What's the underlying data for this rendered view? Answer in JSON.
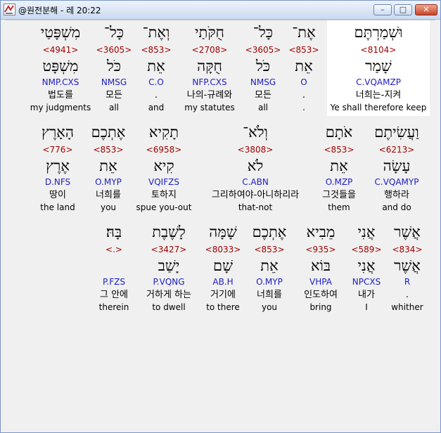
{
  "window": {
    "title": "@원전분해 - 레 20:22",
    "minimize": "–",
    "maximize": "□",
    "close": "✕"
  },
  "rows": [
    {
      "words": [
        {
          "heb": "וּשְׁמַרְתֶּם",
          "strong": "<8104>",
          "lemma": "שָׁמַר",
          "morph": "C.VQAMZP",
          "kor": "너희는-지켜",
          "eng": "Ye shall therefore keep",
          "selected": true
        },
        {
          "heb": "אֶת־",
          "strong": "<853>",
          "lemma": "אֵת",
          "morph": "O",
          "kor": ".",
          "eng": "."
        },
        {
          "heb": "כָּל־",
          "strong": "<3605>",
          "lemma": "כֹּל",
          "morph": "NMSG",
          "kor": "모든",
          "eng": "all"
        },
        {
          "heb": "חֻקֹּתַי",
          "strong": "<2708>",
          "lemma": "חֻקָּה",
          "morph": "NFP.CXS",
          "kor": "나의-규례와",
          "eng": "my statutes"
        },
        {
          "heb": "וְאֶת־",
          "strong": "<853>",
          "lemma": "אֵת",
          "morph": "C.O",
          "kor": ".",
          "eng": "and"
        },
        {
          "heb": "כָּל־",
          "strong": "<3605>",
          "lemma": "כֹּל",
          "morph": "NMSG",
          "kor": "모든",
          "eng": "all"
        },
        {
          "heb": "מִשְׁפָּטַי",
          "strong": "<4941>",
          "lemma": "מִשְׁפָּט",
          "morph": "NMP.CXS",
          "kor": "법도를",
          "eng": "my judgments"
        }
      ]
    },
    {
      "words": [
        {
          "heb": "וַעֲשִׂיתֶם",
          "strong": "<6213>",
          "lemma": "עָשָׂה",
          "morph": "C.VQAMYP",
          "kor": "행하라",
          "eng": "and do"
        },
        {
          "heb": "אֹתָם",
          "strong": "<853>",
          "lemma": "אֵת",
          "morph": "O.MZP",
          "kor": "그것들을",
          "eng": "them"
        },
        {
          "heb": "וְלֹא־",
          "strong": "<3808>",
          "lemma": "לֹא",
          "morph": "C.ABN",
          "kor": "그리하여야-아니하리라",
          "eng": "that-not"
        },
        {
          "heb": "תָקִיא",
          "strong": "<6958>",
          "lemma": "קִיא",
          "morph": "VQIFZS",
          "kor": "토하지",
          "eng": "spue you-out"
        },
        {
          "heb": "אֶתְכֶם",
          "strong": "<853>",
          "lemma": "אֵת",
          "morph": "O.MYP",
          "kor": "너희를",
          "eng": "you"
        },
        {
          "heb": "הָאָרֶץ",
          "strong": "<776>",
          "lemma": "אֶרֶץ",
          "morph": "D.NFS",
          "kor": "땅이",
          "eng": "the land"
        }
      ]
    },
    {
      "words": [
        {
          "heb": "אֲשֶׁר",
          "strong": "<834>",
          "lemma": "אֲשֶׁר",
          "morph": "R",
          "kor": ".",
          "eng": "whither"
        },
        {
          "heb": "אֲנִי",
          "strong": "<589>",
          "lemma": "אֲנִי",
          "morph": "NPCXS",
          "kor": "내가",
          "eng": "I"
        },
        {
          "heb": "מֵבִיא",
          "strong": "<935>",
          "lemma": "בּוֹא",
          "morph": "VHPA",
          "kor": "인도하여",
          "eng": "bring"
        },
        {
          "heb": "אֶתְכֶם",
          "strong": "<853>",
          "lemma": "אֵת",
          "morph": "O.MYP",
          "kor": "너희를",
          "eng": "you"
        },
        {
          "heb": "שָׁמָּה",
          "strong": "<8033>",
          "lemma": "שָׁם",
          "morph": "AB.H",
          "kor": "거기에",
          "eng": "to there"
        },
        {
          "heb": "לָשֶׁבֶת",
          "strong": "<3427>",
          "lemma": "יָשַׁב",
          "morph": "P.VQNG",
          "kor": "거하게 하는",
          "eng": "to dwell"
        },
        {
          "heb": "בָּהּ׃",
          "strong": "<.>",
          "lemma": "",
          "morph": "P.FZS",
          "kor": "그 안에",
          "eng": "therein"
        }
      ]
    }
  ]
}
